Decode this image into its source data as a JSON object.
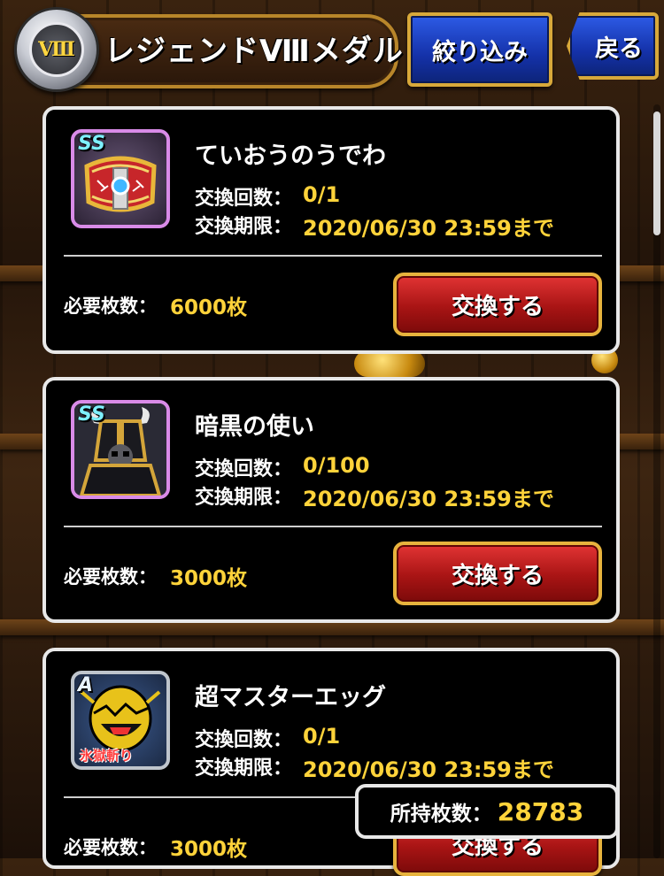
{
  "header": {
    "medal_roman": "Ⅷ",
    "title": "レジェンドⅧメダル",
    "filter_label": "絞り込み",
    "back_label": "戻る"
  },
  "items": [
    {
      "name": "ていおうのうでわ",
      "rank": "SS",
      "icon": "bracelet-icon",
      "count_label": "交換回数：",
      "count_value": "0/1",
      "deadline_label": "交換期限：",
      "deadline_value": "2020/06/30 23:59まで",
      "cost_label": "必要枚数：",
      "cost_value": "6000枚",
      "button_label": "交換する"
    },
    {
      "name": "暗黒の使い",
      "rank": "SS",
      "icon": "dark-knight-icon",
      "count_label": "交換回数：",
      "count_value": "0/100",
      "deadline_label": "交換期限：",
      "deadline_value": "2020/06/30 23:59まで",
      "cost_label": "必要枚数：",
      "cost_value": "3000枚",
      "button_label": "交換する"
    },
    {
      "name": "超マスターエッグ",
      "rank": "A",
      "icon": "master-egg-icon",
      "icon_caption": "氷獄斬り",
      "count_label": "交換回数：",
      "count_value": "0/1",
      "deadline_label": "交換期限：",
      "deadline_value": "2020/06/30 23:59まで",
      "cost_label": "必要枚数：",
      "cost_value": "3000枚",
      "button_label": "交換する"
    }
  ],
  "owned": {
    "label": "所持枚数：",
    "value": "28783"
  }
}
